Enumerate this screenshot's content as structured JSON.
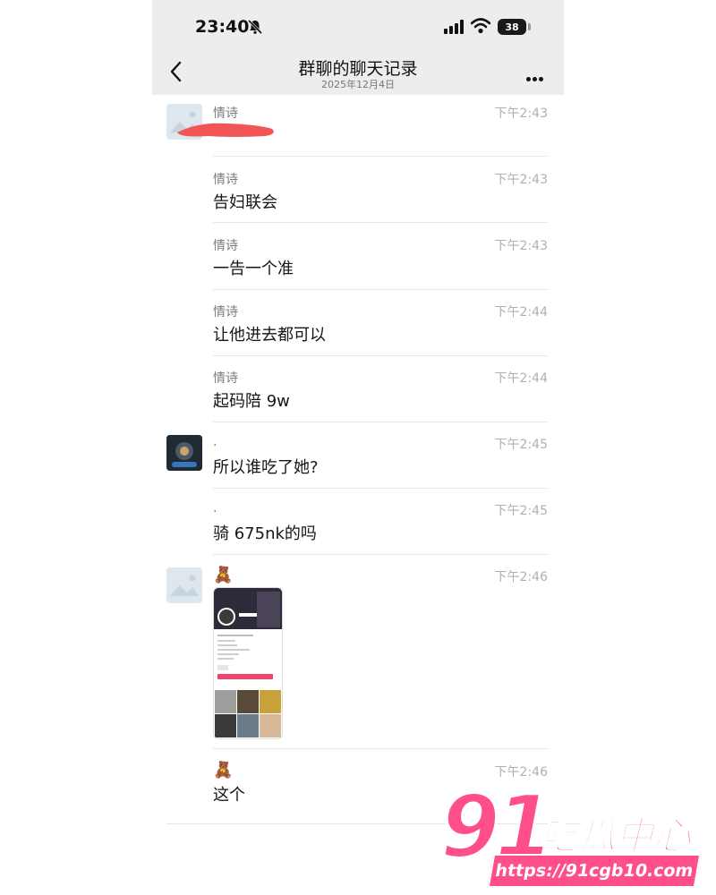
{
  "status_bar": {
    "time": "23:40",
    "battery": "38"
  },
  "nav": {
    "title": "群聊的聊天记录",
    "subtitle": "2025年12月4日"
  },
  "messages": [
    {
      "sender": "情诗",
      "time": "下午2:43",
      "text": ""
    },
    {
      "sender": "情诗",
      "time": "下午2:43",
      "text": "告妇联会"
    },
    {
      "sender": "情诗",
      "time": "下午2:43",
      "text": "一告一个准"
    },
    {
      "sender": "情诗",
      "time": "下午2:44",
      "text": "让他进去都可以"
    },
    {
      "sender": "情诗",
      "time": "下午2:44",
      "text": "起码陪 9w"
    },
    {
      "sender": ".",
      "time": "下午2:45",
      "text": "所以谁吃了她?"
    },
    {
      "sender": ".",
      "time": "下午2:45",
      "text": "骑 675nk的吗"
    },
    {
      "sender": "🧸",
      "time": "下午2:46",
      "text": ""
    },
    {
      "sender": "🧸",
      "time": "下午2:46",
      "text": "这个"
    }
  ],
  "watermark": {
    "number": "91",
    "text": "吃瓜中心",
    "url": "https://91cgb10.com"
  },
  "colors": {
    "header_bg": "#ededed",
    "watermark": "#ff4f8b",
    "redaction": "#f25555"
  }
}
